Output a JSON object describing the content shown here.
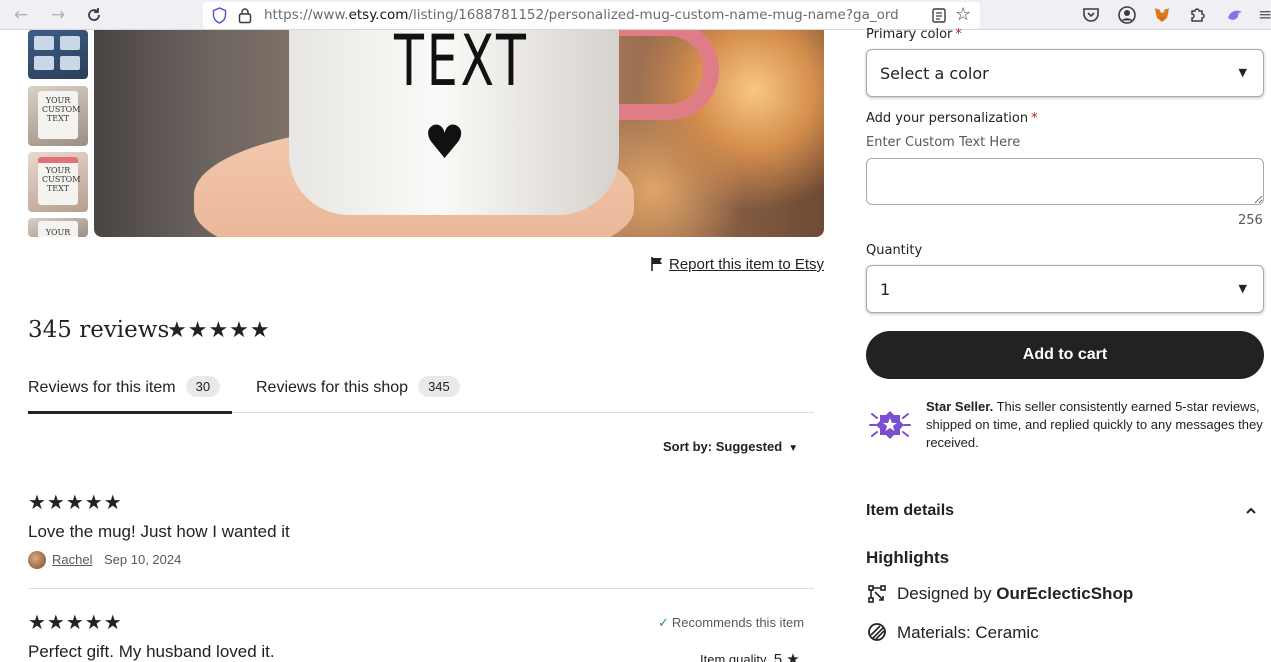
{
  "browser": {
    "url_prefix": "https://www.",
    "url_host": "etsy.com",
    "url_path": "/listing/1688781152/personalized-mug-custom-name-mug-name?ga_ord"
  },
  "gallery": {
    "thumb_texts": [
      "",
      "YOUR CUSTOM TEXT",
      "YOUR CUSTOM TEXT",
      "YOUR"
    ],
    "mug_text": "TEXT",
    "report_link": "Report this item to Etsy"
  },
  "reviews": {
    "count_title": "345 reviews",
    "stars": "★★★★★",
    "tabs": [
      {
        "label": "Reviews for this item",
        "count": "30"
      },
      {
        "label": "Reviews for this shop",
        "count": "345"
      }
    ],
    "sort_label": "Sort by: Suggested",
    "items": [
      {
        "stars": "★★★★★",
        "text": "Love the mug! Just how I wanted it",
        "author": "Rachel",
        "date": "Sep 10, 2024"
      },
      {
        "stars": "★★★★★",
        "text": "Perfect gift. My husband loved it.",
        "recommends": "Recommends this item",
        "quality_label": "Item quality",
        "quality_value": "5 ★"
      }
    ]
  },
  "purchase": {
    "primary_color_label": "Primary color",
    "primary_color_value": "Select a color",
    "personalization_label": "Add your personalization",
    "personalization_hint": "Enter Custom Text Here",
    "personalization_counter": "256",
    "quantity_label": "Quantity",
    "quantity_value": "1",
    "add_to_cart": "Add to cart",
    "required_mark": "*"
  },
  "star_seller": {
    "title": "Star Seller.",
    "description": " This seller consistently earned 5-star reviews, shipped on time, and replied quickly to any messages they received."
  },
  "details": {
    "item_details_label": "Item details",
    "highlights_label": "Highlights",
    "designed_by_prefix": "Designed by ",
    "designer": "OurEclecticShop",
    "materials": "Materials: Ceramic"
  },
  "colors": {
    "star_seller_purple": "#7b4fd1",
    "recommend_green": "#2f8f5b",
    "required_red": "#b3261e",
    "button_dark": "#222222"
  }
}
